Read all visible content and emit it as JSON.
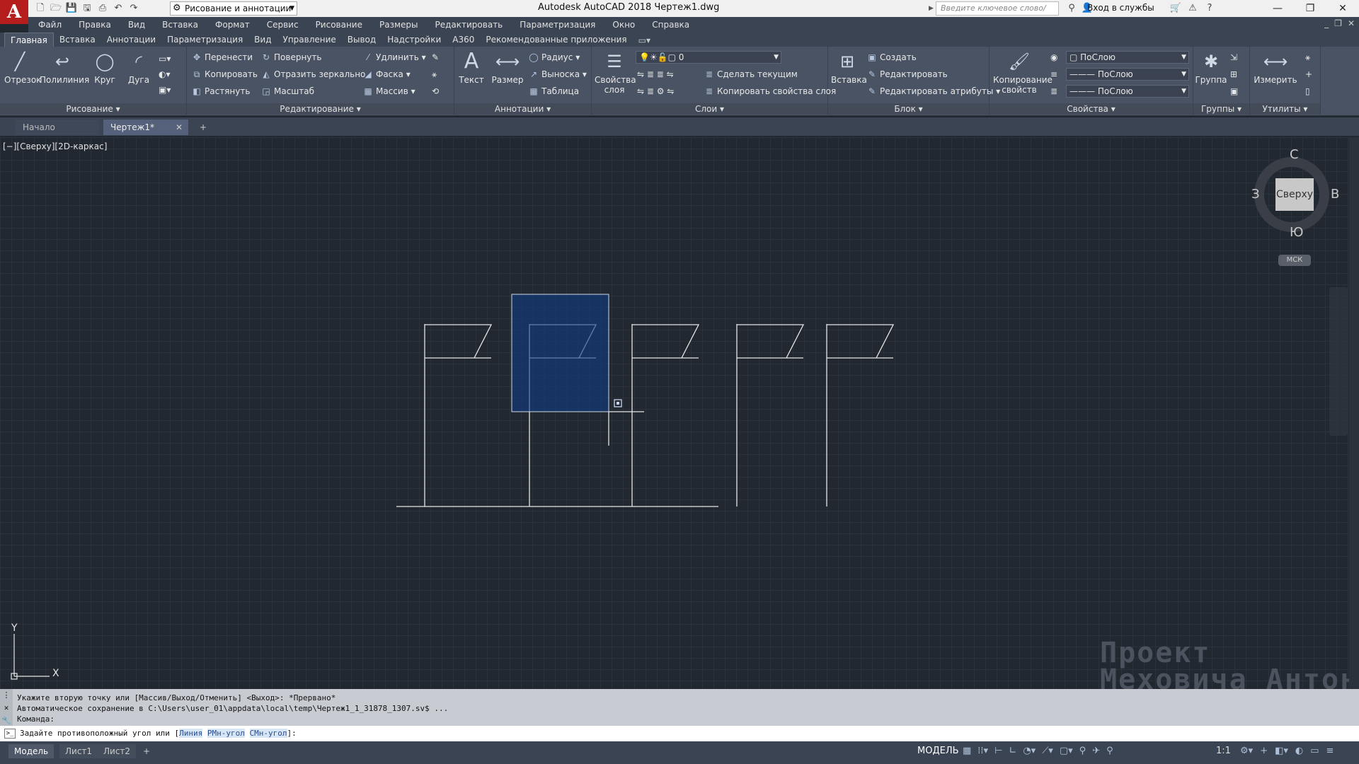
{
  "title_bar": {
    "app_title": "Autodesk AutoCAD 2018    Чертеж1.dwg",
    "workspace": "Рисование и аннотации",
    "search_placeholder": "Введите ключевое слово/фразу",
    "sign_in": "Вход в службы",
    "logo": "A"
  },
  "menu": [
    "Файл",
    "Правка",
    "Вид",
    "Вставка",
    "Формат",
    "Сервис",
    "Рисование",
    "Размеры",
    "Редактировать",
    "Параметризация",
    "Окно",
    "Справка"
  ],
  "ribbon_tabs": [
    "Главная",
    "Вставка",
    "Аннотации",
    "Параметризация",
    "Вид",
    "Управление",
    "Вывод",
    "Надстройки",
    "A360",
    "Рекомендованные приложения"
  ],
  "ribbon": {
    "draw": {
      "title": "Рисование",
      "line": "Отрезок",
      "polyline": "Полилиния",
      "circle": "Круг",
      "arc": "Дуга"
    },
    "modify": {
      "title": "Редактирование",
      "move": "Перенести",
      "rotate": "Повернуть",
      "trim": "Удлинить",
      "copy": "Копировать",
      "mirror": "Отразить зеркально",
      "fillet": "Фаска",
      "stretch": "Растянуть",
      "scale": "Масштаб",
      "array": "Массив"
    },
    "annotation": {
      "title": "Аннотации",
      "text": "Текст",
      "dimension": "Размер",
      "radius": "Радиус",
      "leader": "Выноска",
      "table": "Таблица"
    },
    "layers": {
      "title": "Слои",
      "properties": "Свойства слоя",
      "current_layer": "0",
      "make_current": "Сделать текущим",
      "match_layer": "Копировать свойства слоя"
    },
    "block": {
      "title": "Блок",
      "insert": "Вставка",
      "create": "Создать",
      "edit": "Редактировать",
      "edit_attributes": "Редактировать атрибуты"
    },
    "properties": {
      "title": "Свойства",
      "match": "Копирование свойств",
      "color": "ПоСлою",
      "linetype": "ПоСлою",
      "lineweight": "ПоСлою"
    },
    "groups": {
      "title": "Группы",
      "group": "Группа"
    },
    "utilities": {
      "title": "Утилиты",
      "measure": "Измерить"
    }
  },
  "doc_tabs": {
    "start": "Начало",
    "drawing": "Чертеж1*"
  },
  "viewport": {
    "label": "[−][Сверху][2D-каркас]",
    "viewcube": {
      "face": "Сверху",
      "north": "С",
      "south": "Ю",
      "west": "З",
      "east": "В",
      "ucs": "МСК"
    },
    "axis_x": "X",
    "axis_y": "Y",
    "watermark_line1": "Проект",
    "watermark_line2": "Меховича Антона"
  },
  "command": {
    "history": [
      "Укажите вторую точку или [Массив/Выход/Отменить] <Выход>: *Прервано*",
      "Автоматическое сохранение в C:\\Users\\user_01\\appdata\\local\\temp\\Чертеж1_1_31878_1307.sv$ ...",
      "Команда:"
    ],
    "prompt": "Задайте противоположный угол или [",
    "opt_line": "Линия",
    "opt_rm": "РМн-угол",
    "opt_sm": "СМн-угол",
    "prompt_end": "]:"
  },
  "status": {
    "model_tab": "Модель",
    "layout1": "Лист1",
    "layout2": "Лист2",
    "model_button": "МОДЕЛЬ",
    "scale": "1:1"
  }
}
